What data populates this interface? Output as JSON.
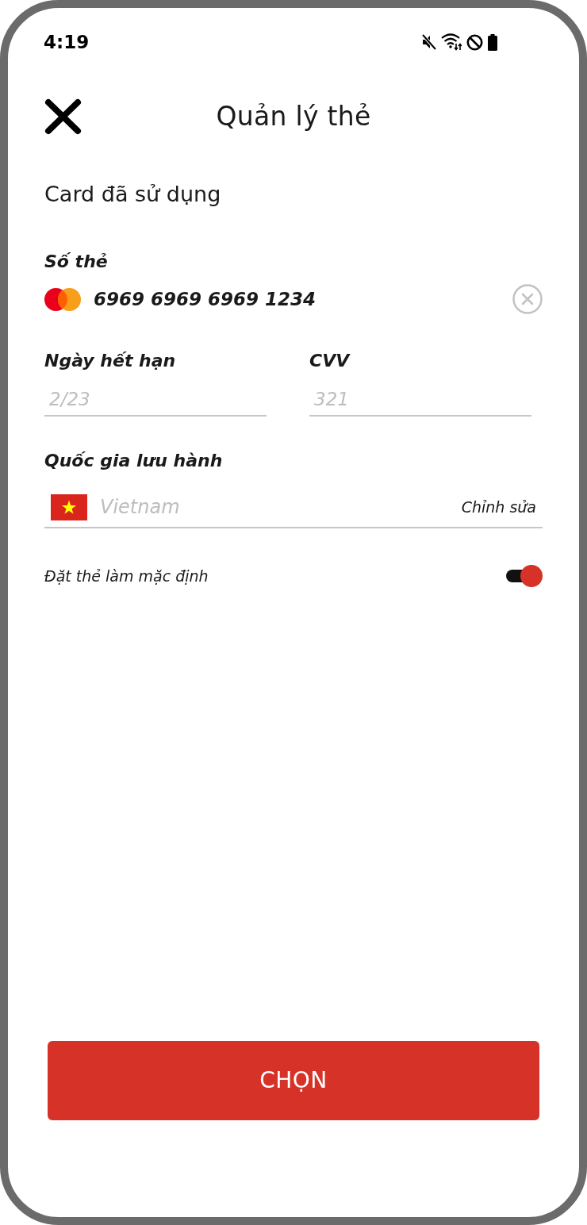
{
  "status_bar": {
    "time": "4:19"
  },
  "header": {
    "title": "Quản lý thẻ"
  },
  "section_title": "Card đã sử dụng",
  "card_number": {
    "label": "Số thẻ",
    "value": "6969 6969 6969 1234"
  },
  "expiry": {
    "label": "Ngày hết hạn",
    "placeholder": "2/23"
  },
  "cvv": {
    "label": "CVV",
    "placeholder": "321"
  },
  "country": {
    "label": "Quốc gia lưu hành",
    "placeholder": "Vietnam",
    "edit_link": "Chỉnh sửa"
  },
  "default_toggle": {
    "label": "Đặt thẻ làm mặc định",
    "on": true
  },
  "primary_button": {
    "label": "CHỌN"
  }
}
